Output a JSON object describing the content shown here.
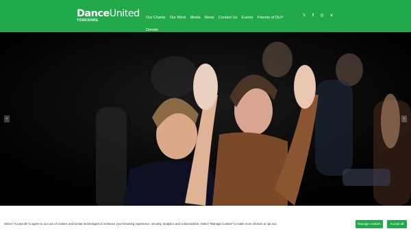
{
  "logo": {
    "word1": "Dance",
    "word2": "United",
    "subtitle": "YORKSHIRE"
  },
  "nav": {
    "items": [
      "Our Charity",
      "Our Work",
      "Media",
      "News",
      "Contact Us",
      "Events",
      "Friends of DUY",
      "Donate"
    ]
  },
  "social": {
    "x": "𝕏",
    "facebook": "f",
    "instagram": "◎",
    "vimeo": "v"
  },
  "slider": {
    "prev": "‹",
    "next": "›"
  },
  "cookie": {
    "text": "Select \"Accept all\" to agree to our use of cookies and similar technologies to enhance your browsing experience, security, analytics and customization. Select \"Manage cookies\" to make more choices or opt out.",
    "manage_label": "Manage cookies",
    "accept_label": "Accept all"
  },
  "colors": {
    "brand_green": "#22a94a"
  }
}
